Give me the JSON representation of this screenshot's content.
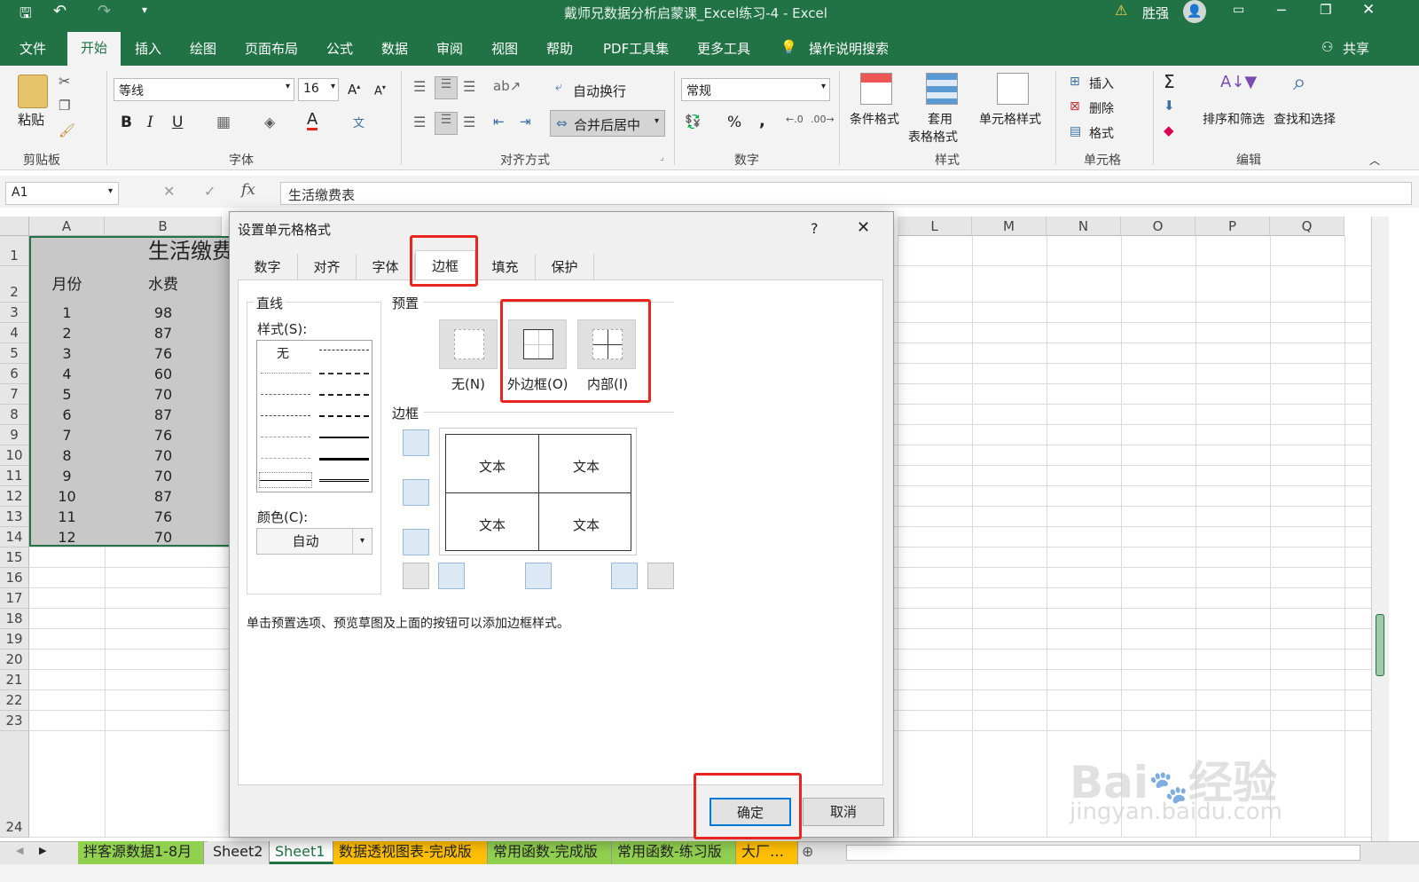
{
  "window": {
    "title": "戴师兄数据分析启蒙课_Excel练习-4  -  Excel",
    "user": "胜强"
  },
  "menu": {
    "file": "文件",
    "home": "开始",
    "insert": "插入",
    "draw": "绘图",
    "layout": "页面布局",
    "formula": "公式",
    "data": "数据",
    "review": "审阅",
    "view": "视图",
    "help": "帮助",
    "pdf": "PDF工具集",
    "more": "更多工具",
    "tell": "操作说明搜索",
    "share": "共享"
  },
  "ribbon": {
    "clipboard": {
      "paste": "粘贴",
      "label": "剪贴板"
    },
    "font": {
      "name": "等线",
      "size": "16",
      "label": "字体",
      "bold": "B",
      "italic": "I",
      "underline": "U"
    },
    "align": {
      "wrap": "自动换行",
      "merge": "合并后居中",
      "label": "对齐方式"
    },
    "number": {
      "format": "常规",
      "percent": "%",
      "comma": ",",
      "label": "数字"
    },
    "styles": {
      "cond": "条件格式",
      "table_l1": "套用",
      "table_l2": "表格格式",
      "cell": "单元格样式",
      "label": "样式"
    },
    "cells": {
      "insert": "插入",
      "delete": "删除",
      "format": "格式",
      "label": "单元格"
    },
    "edit": {
      "sort": "排序和筛选",
      "find": "查找和选择",
      "label": "编辑"
    }
  },
  "formula_bar": {
    "name_box": "A1",
    "fx": "fx",
    "content": "生活缴费表"
  },
  "columns": [
    "A",
    "B",
    "L",
    "M",
    "N",
    "O",
    "P",
    "Q"
  ],
  "rows": [
    "1",
    "2",
    "3",
    "4",
    "5",
    "6",
    "7",
    "8",
    "9",
    "10",
    "11",
    "12",
    "13",
    "14",
    "15",
    "16",
    "17",
    "18",
    "19",
    "20",
    "21",
    "22",
    "23",
    "24"
  ],
  "table": {
    "title": "生活缴费",
    "headers": [
      "月份",
      "水费"
    ],
    "data": [
      [
        "1",
        "98"
      ],
      [
        "2",
        "87"
      ],
      [
        "3",
        "76"
      ],
      [
        "4",
        "60"
      ],
      [
        "5",
        "70"
      ],
      [
        "6",
        "87"
      ],
      [
        "7",
        "76"
      ],
      [
        "8",
        "70"
      ],
      [
        "9",
        "70"
      ],
      [
        "10",
        "87"
      ],
      [
        "11",
        "76"
      ],
      [
        "12",
        "70"
      ]
    ]
  },
  "sheets": [
    "拌客源数据1-8月",
    "Sheet2",
    "Sheet1",
    "数据透视图表-完成版",
    "常用函数-完成版",
    "常用函数-练习版",
    "大厂…"
  ],
  "sheet_colors": {
    "green": "#92d050",
    "yellow": "#ffc000",
    "active": "#ffffff"
  },
  "dialog": {
    "title": "设置单元格格式",
    "help": "?",
    "close": "✕",
    "tabs": [
      "数字",
      "对齐",
      "字体",
      "边框",
      "填充",
      "保护"
    ],
    "line_section": "直线",
    "style_label": "样式(S):",
    "none_label": "无",
    "color_label": "颜色(C):",
    "color_value": "自动",
    "preset_section": "预置",
    "presets": [
      "无(N)",
      "外边框(O)",
      "内部(I)"
    ],
    "border_section": "边框",
    "preview_text": "文本",
    "hint": "单击预置选项、预览草图及上面的按钮可以添加边框样式。",
    "ok": "确定",
    "cancel": "取消"
  },
  "watermark": {
    "brand": "Bai",
    "brand2": "经验",
    "url": "jingyan.baidu.com"
  },
  "accent": "#217346",
  "highlight": "#e8251f"
}
